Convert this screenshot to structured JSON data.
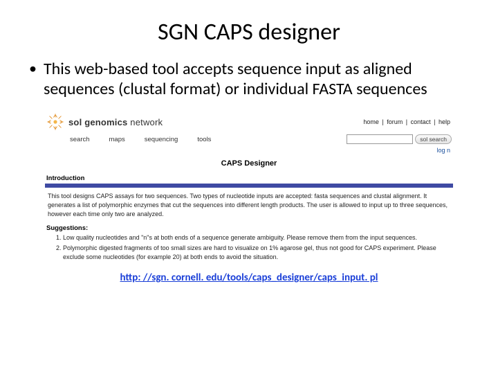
{
  "title": "SGN CAPS designer",
  "bullet": "This web-based tool accepts sequence input as aligned sequences (clustal format) or individual FASTA sequences",
  "url": "http: //sgn. cornell. edu/tools/caps_designer/caps_input. pl",
  "screenshot": {
    "site_prefix": "sol genomics",
    "site_suffix": " network",
    "toplinks": [
      "home",
      "forum",
      "contact",
      "help"
    ],
    "tabs": [
      "search",
      "maps",
      "sequencing",
      "tools"
    ],
    "search_btn": "sol search",
    "login": "log n",
    "page_heading": "CAPS Designer",
    "intro_label": "Introduction",
    "intro_body": "This tool designs CAPS assays for two sequences. Two types of nucleotide inputs are accepted: fasta sequences and clustal alignment. It generates a list of polymorphic enzymes that cut the sequences into different length products. The user is allowed to input up to three sequences, however each time only two are analyzed.",
    "sugg_label": "Suggestions:",
    "suggestions": [
      "Low quality nucleotides and \"n\"s at both ends of a sequence generate ambiguity. Please remove them from the input sequences.",
      "Polymorphic digested fragments of too small sizes are hard to visualize on 1% agarose gel, thus not good for CAPS experiment. Please exclude some nucleotides (for example 20) at both ends to avoid the situation."
    ]
  }
}
